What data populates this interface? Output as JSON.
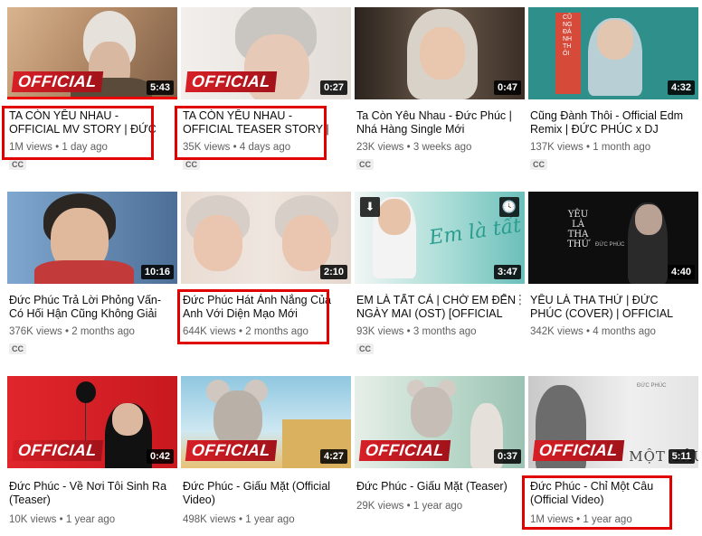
{
  "videos": [
    {
      "title": "TA CÒN YÊU NHAU - OFFICIAL MV STORY | ĐỨC",
      "views": "1M views",
      "age": "1 day ago",
      "duration": "5:43",
      "cc": "CC",
      "badge": "OFFICIAL",
      "thumb_bg": "#c9a07c"
    },
    {
      "title": "TA CÒN YÊU NHAU - OFFICIAL TEASER STORY |",
      "views": "35K views",
      "age": "4 days ago",
      "duration": "0:27",
      "cc": "CC",
      "badge": "OFFICIAL",
      "thumb_bg": "#e9e4e0"
    },
    {
      "title": "Ta Còn Yêu Nhau - Đức Phúc | Nhá Hàng Single Mới",
      "views": "23K views",
      "age": "3 weeks ago",
      "duration": "0:47",
      "cc": "CC",
      "thumb_bg": "#5a4a3d"
    },
    {
      "title": "Cũng Đành Thôi - Official Edm Remix | ĐỨC PHÚC x DJ",
      "views": "137K views",
      "age": "1 month ago",
      "duration": "4:32",
      "cc": "CC",
      "thumb_bg": "#2f8f8a"
    },
    {
      "title": "Đức Phúc Trả Lời Phỏng Vấn- Có Hối Hận Cũng Không Giải",
      "views": "376K views",
      "age": "2 months ago",
      "duration": "10:16",
      "cc": "CC",
      "thumb_bg": "#6b8fb5"
    },
    {
      "title": "Đức Phúc Hát Ánh Nắng Của Anh Với Diện Mạo Mới",
      "views": "644K views",
      "age": "2 months ago",
      "duration": "2:10",
      "thumb_bg": "#e6d8cf"
    },
    {
      "title": "EM LÀ TẤT CẢ | CHỜ EM ĐẾN NGÀY MAI (OST) [OFFICIAL",
      "views": "93K views",
      "age": "3 months ago",
      "duration": "3:47",
      "cc": "CC",
      "thumb_bg": "#7ec9c4"
    },
    {
      "title": "YÊU LÀ THA THỨ | ĐỨC PHÚC (COVER) | OFFICIAL",
      "views": "342K views",
      "age": "4 months ago",
      "duration": "4:40",
      "thumb_bg": "#111111"
    },
    {
      "title": "Đức Phúc - Về Nơi Tôi Sinh Ra (Teaser)",
      "views": "10K views",
      "age": "1 year ago",
      "duration": "0:42",
      "badge": "OFFICIAL",
      "thumb_bg": "#c8191f"
    },
    {
      "title": "Đức Phúc - Giấu Mặt (Official Video)",
      "views": "498K views",
      "age": "1 year ago",
      "duration": "4:27",
      "badge": "OFFICIAL",
      "thumb_bg": "#8fc7e0"
    },
    {
      "title": "Đức Phúc - Giấu Mặt (Teaser)",
      "views": "29K views",
      "age": "1 year ago",
      "duration": "0:37",
      "badge": "OFFICIAL",
      "thumb_bg": "#b7d6c8"
    },
    {
      "title": "Đức Phúc - Chỉ Một Câu (Official Video)",
      "views": "1M views",
      "age": "1 year ago",
      "duration": "5:11",
      "badge": "OFFICIAL",
      "thumb_bg": "#d9d9d9",
      "thumb_text": "CHỈ MỘT CÂU",
      "thumb_text2": "ĐỨC PHÚC"
    }
  ],
  "thumb_texts": {
    "v3_vertical": "CŨNG ĐÀNH THÔI",
    "v7_script": "Em là tất cả",
    "v8_title": "YÊU LÀ THA THỨ",
    "v8_sub": "ĐỨC PHÚC"
  },
  "separator": "•",
  "colors": {
    "highlight": "#e00000",
    "progress": "#ee0000"
  }
}
